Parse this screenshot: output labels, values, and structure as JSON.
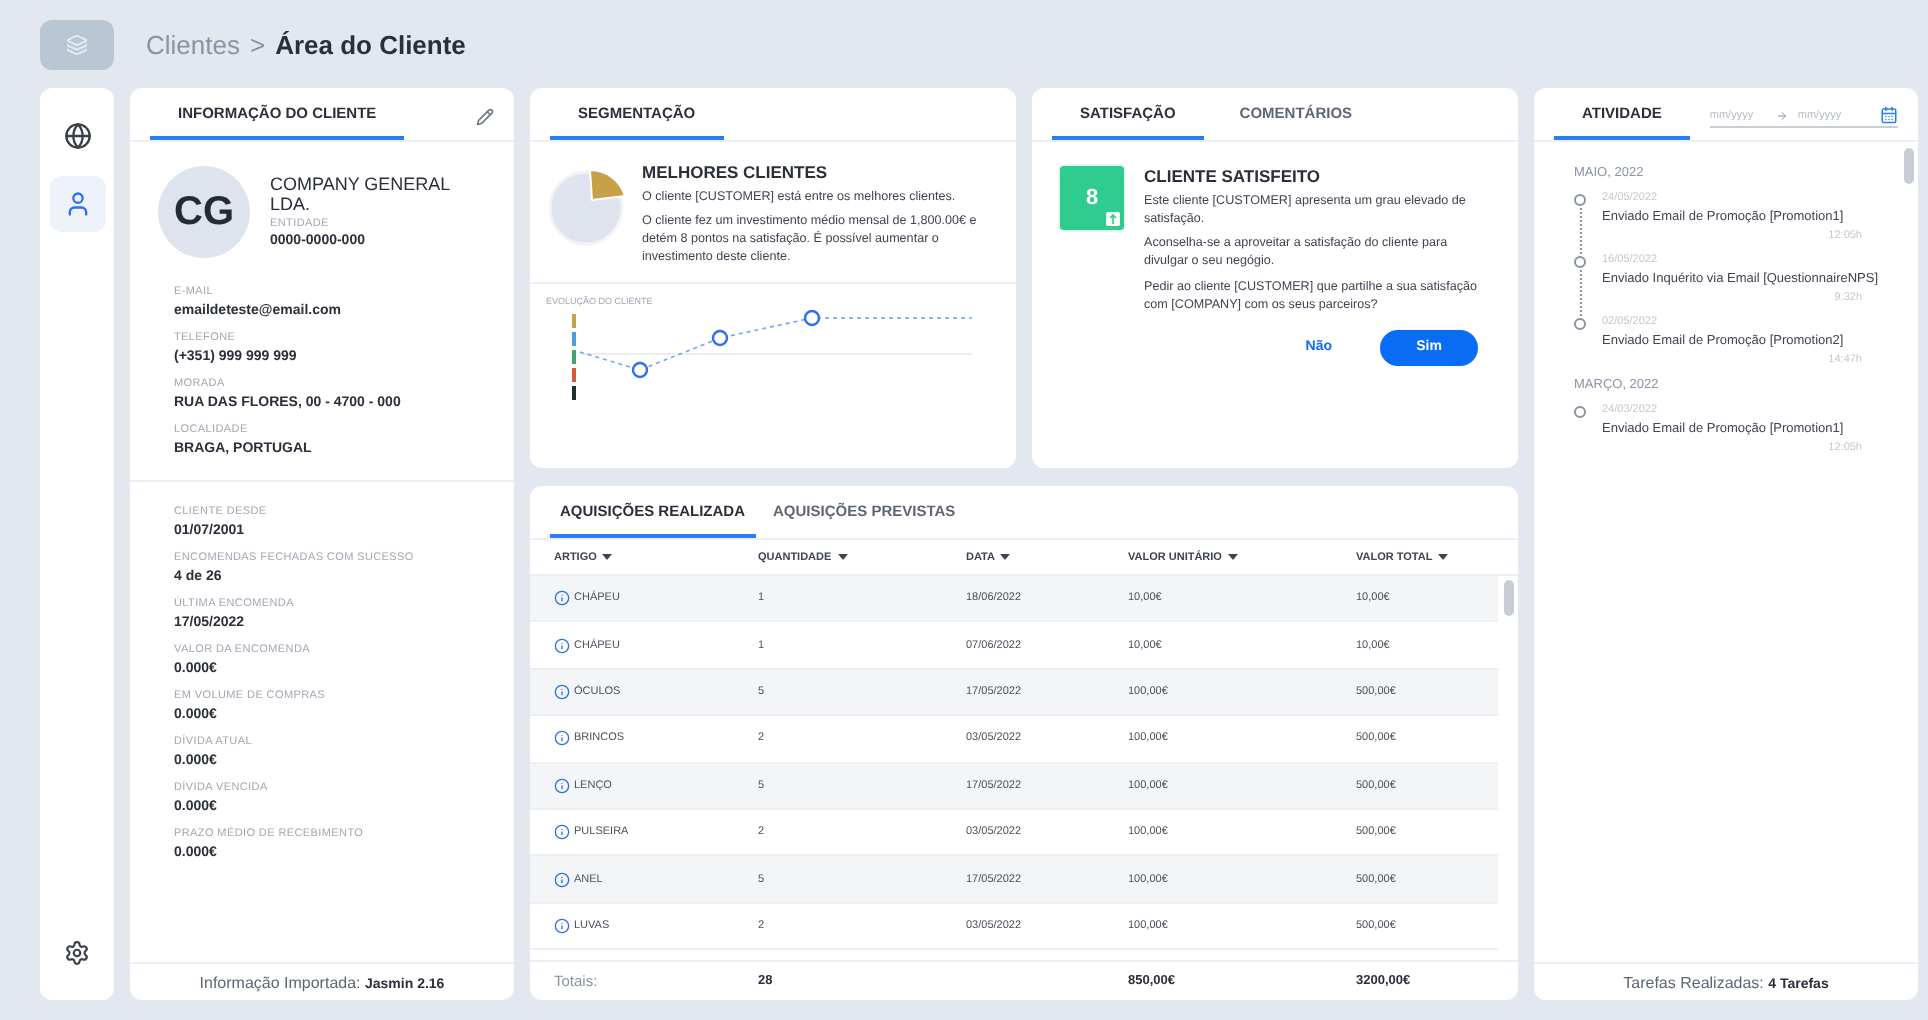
{
  "breadcrumb": {
    "parent": "Clientes",
    "separator": ">",
    "current": "Área do Cliente"
  },
  "sidebar": {
    "items": [
      {
        "kind": "globe",
        "selected": false
      },
      {
        "kind": "user",
        "selected": true
      }
    ]
  },
  "client_panel": {
    "tab": {
      "label": "INFORMAÇÃO DO CLIENTE",
      "selected": true
    },
    "avatar": "CG",
    "name": "COMPANY GENERAL LDA.",
    "entity_label": "ENTIDADE",
    "entity": "0000-0000-000",
    "contact_fields": [
      {
        "label": "E-MAIL",
        "value": "emaildeteste@email.com"
      },
      {
        "label": "TELEFONE",
        "value": "(+351) 999 999 999"
      },
      {
        "label": "MORADA",
        "value": "RUA DAS FLORES, 00 - 4700 - 000"
      },
      {
        "label": "LOCALIDADE",
        "value": "BRAGA, PORTUGAL"
      }
    ],
    "stats": [
      {
        "label": "CLIENTE DESDE",
        "value": "01/07/2001"
      },
      {
        "label": "ENCOMENDAS FECHADAS COM SUCESSO",
        "value": "4 de 26"
      },
      {
        "label": "ÚLTIMA ENCOMENDA",
        "value": "17/05/2022"
      },
      {
        "label": "VALOR DA ENCOMENDA",
        "value": "0.000€"
      },
      {
        "label": "EM VOLUME DE COMPRAS",
        "value": "0.000€"
      },
      {
        "label": "DÍVIDA ATUAL",
        "value": "0.000€"
      },
      {
        "label": "DÍVIDA VENCIDA",
        "value": "0.000€"
      },
      {
        "label": "PRAZO MÉDIO DE RECEBIMENTO",
        "value": "0.000€"
      }
    ],
    "footer": "Informação Importada: **Jasmin 2.16**"
  },
  "segmentation": {
    "tab": {
      "label": "SEGMENTAÇÃO",
      "selected": true
    },
    "title": "MELHORES CLIENTES",
    "paragraphs": [
      "O cliente [CUSTOMER] está entre os melhores clientes.",
      "O cliente fez um investimento médio mensal de 1,800.00€ e detém 8 pontos na satisfação. É possível aumentar o investimento deste cliente."
    ],
    "chart_title": "EVOLUÇÃO DO CLIENTE"
  },
  "satisfaction": {
    "tabs": [
      {
        "label": "SATISFAÇÃO",
        "selected": true
      },
      {
        "label": "COMENTÁRIOS",
        "selected": false
      }
    ],
    "score": "8",
    "title": "CLIENTE SATISFEITO",
    "paragraphs": [
      "Este cliente [CUSTOMER] apresenta um grau elevado de satisfação.",
      "Aconselha-se a aproveitar a satisfação do cliente para divulgar o seu negógio.",
      "Pedir ao cliente [CUSTOMER] que partilhe a sua satisfação com [COMPANY] com os seus parceiros?"
    ],
    "buttons": [
      {
        "label": "Não",
        "kind": "text"
      },
      {
        "label": "Sim",
        "kind": "primary"
      }
    ]
  },
  "purchases": {
    "tabs": [
      {
        "label": "AQUISIÇÕES REALIZADA",
        "selected": true
      },
      {
        "label": "AQUISIÇÕES PREVISTAS",
        "selected": false
      }
    ],
    "columns": [
      "ARTIGO",
      "QUANTIDADE",
      "DATA",
      "VALOR UNITÁRIO",
      "VALOR TOTAL"
    ],
    "rows": [
      [
        "CHÁPEU",
        "1",
        "18/06/2022",
        "10,00€",
        "10,00€"
      ],
      [
        "CHÁPEU",
        "1",
        "07/06/2022",
        "10,00€",
        "10,00€"
      ],
      [
        "ÓCULOS",
        "5",
        "17/05/2022",
        "100,00€",
        "500,00€"
      ],
      [
        "BRINCOS",
        "2",
        "03/05/2022",
        "100,00€",
        "500,00€"
      ],
      [
        "LENÇO",
        "5",
        "17/05/2022",
        "100,00€",
        "500,00€"
      ],
      [
        "PULSEIRA",
        "2",
        "03/05/2022",
        "100,00€",
        "500,00€"
      ],
      [
        "ANEL",
        "5",
        "17/05/2022",
        "100,00€",
        "500,00€"
      ],
      [
        "LUVAS",
        "2",
        "03/05/2022",
        "100,00€",
        "500,00€"
      ]
    ],
    "totals": {
      "label": "Totais:",
      "quantity": "28",
      "unit_value": "850,00€",
      "total_value": "3200,00€"
    }
  },
  "activity": {
    "tab": {
      "label": "ATIVIDADE",
      "selected": true
    },
    "date_from": {
      "placeholder": "mm/yyyy"
    },
    "date_to": {
      "placeholder": "mm/yyyy"
    },
    "groups": [
      {
        "month": "MAIO, 2022",
        "events": [
          {
            "date": "24/05/2022",
            "text": "Enviado Email de Promoção [Promotion1]",
            "time": "12:05h"
          },
          {
            "date": "16/05/2022",
            "text": "Enviado Inquérito via Email [QuestionnaireNPS]",
            "time": "9:32h"
          },
          {
            "date": "02/05/2022",
            "text": "Enviado Email de Promoção [Promotion2]",
            "time": "14:47h"
          }
        ]
      },
      {
        "month": "MARÇO, 2022",
        "events": [
          {
            "date": "24/03/2022",
            "text": "Enviado Email de Promoção [Promotion1]",
            "time": "12:05h"
          }
        ]
      }
    ],
    "footer": "Tarefas Realizadas: **4 Tarefas**"
  }
}
